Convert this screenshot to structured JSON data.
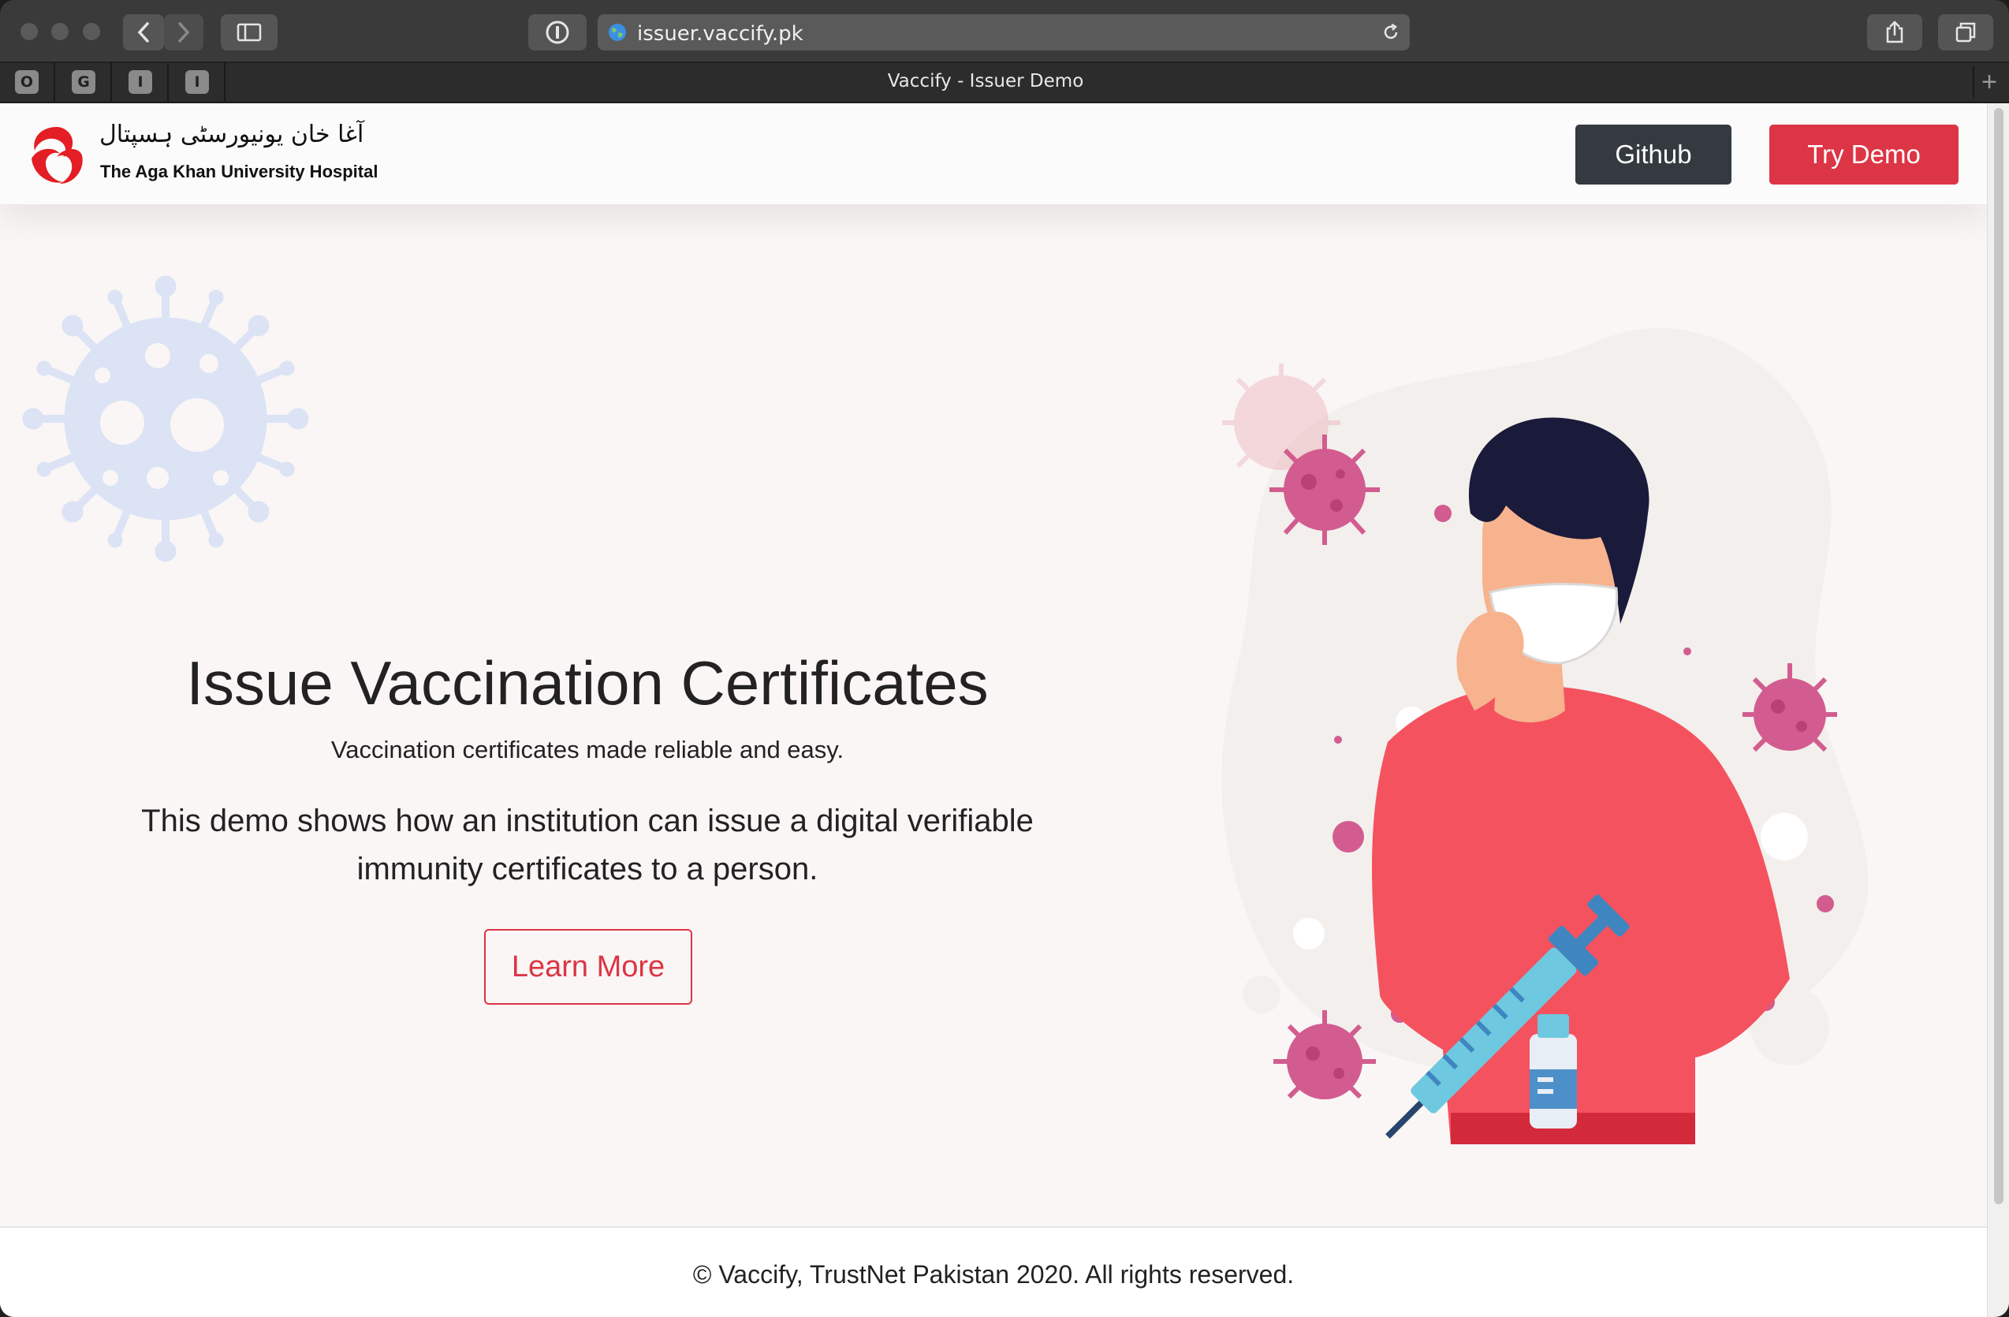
{
  "browser": {
    "url": "issuer.vaccify.pk",
    "tab_title": "Vaccify - Issuer Demo",
    "favorites": [
      "O",
      "G",
      "I",
      "I"
    ],
    "new_tab": "+"
  },
  "header": {
    "logo_urdu": "آغا خان یونیورسٹی ہسپتال",
    "logo_name": "The Aga Khan University Hospital",
    "github_label": "Github",
    "demo_label": "Try Demo"
  },
  "hero": {
    "title": "Issue Vaccination Certificates",
    "subtitle": "Vaccination certificates made reliable and easy.",
    "description": "This demo shows how an institution can issue a digital verifiable immunity certificates to a person.",
    "learn_more_label": "Learn More"
  },
  "footer": {
    "text": "© Vaccify, TrustNet Pakistan 2020. All rights reserved."
  },
  "colors": {
    "primary_red": "#dc3545",
    "dark": "#343a40",
    "page_bg": "#faf6f5"
  }
}
